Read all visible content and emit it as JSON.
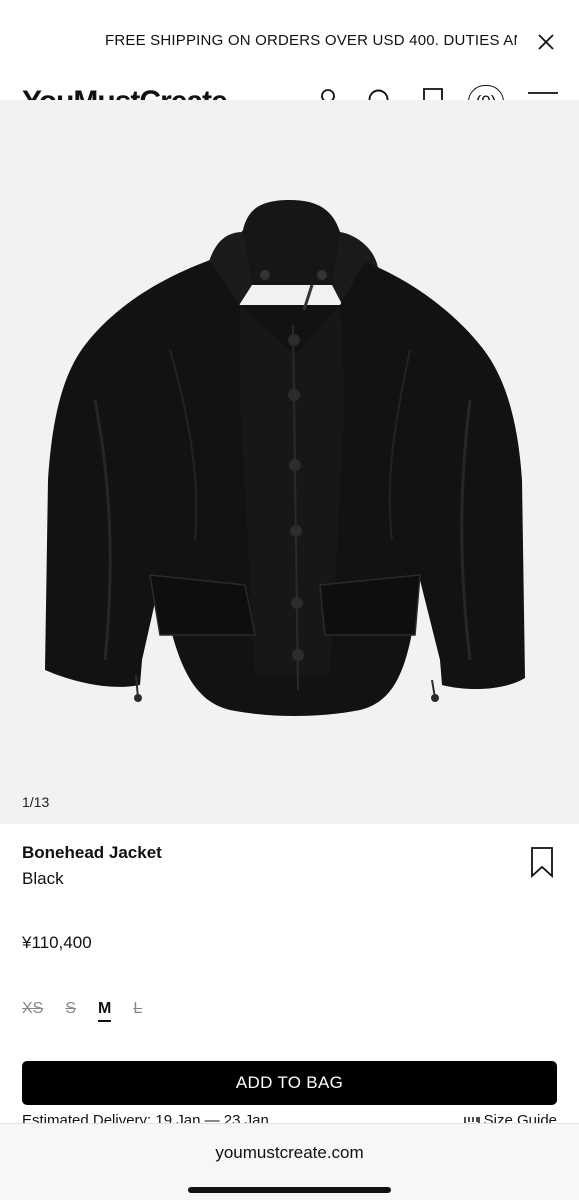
{
  "announcement": {
    "text": "FREE SHIPPING ON ORDERS OVER USD 400. DUTIES AN"
  },
  "header": {
    "logo": "YouMustCreate",
    "bag_count": "(0)"
  },
  "icons": {
    "close": "close-icon",
    "account": "user-icon",
    "search": "search-icon",
    "wishlist": "bookmark-icon",
    "menu": "hamburger-menu-icon"
  },
  "gallery": {
    "counter": "1/13",
    "image": "black hooded jacket product photo"
  },
  "product": {
    "title": "Bonehead Jacket",
    "color": "Black",
    "price": "¥110,400"
  },
  "sizes": [
    {
      "label": "XS",
      "available": false
    },
    {
      "label": "S",
      "available": false
    },
    {
      "label": "M",
      "available": true,
      "selected": true
    },
    {
      "label": "L",
      "available": false
    }
  ],
  "actions": {
    "add_to_bag": "ADD TO BAG",
    "size_guide": "Size Guide"
  },
  "delivery": {
    "text": "Estimated Delivery: 19 Jan — 23 Jan"
  },
  "browser": {
    "url": "youmustcreate.com"
  },
  "colors": {
    "button_bg": "#000000",
    "gallery_bg": "#f2f2f2"
  }
}
